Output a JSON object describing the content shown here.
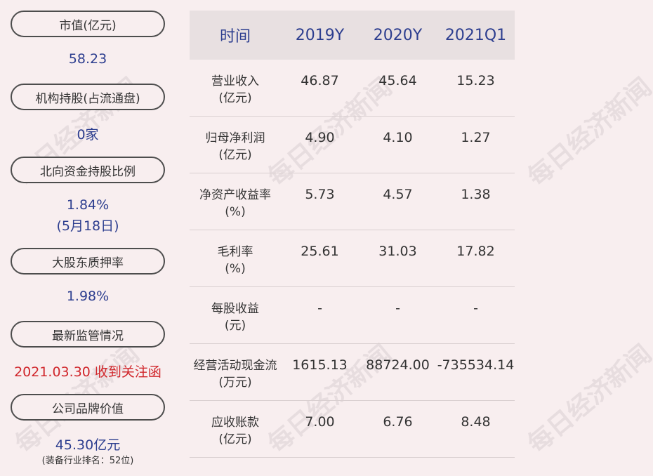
{
  "left_panel": {
    "items": [
      {
        "label": "市值(亿元)",
        "value": "58.23"
      },
      {
        "label": "机构持股(占流通盘)",
        "value": "0家"
      },
      {
        "label": "北向资金持股比例",
        "value_line1": "1.84%",
        "value_line2": "(5月18日)"
      },
      {
        "label": "大股东质押率",
        "value": "1.98%"
      },
      {
        "label": "最新监管情况",
        "value": "2021.03.30 收到关注函"
      },
      {
        "label": "公司品牌价值",
        "value": "45.30亿元",
        "note": "(装备行业排名：52位)"
      }
    ]
  },
  "table": {
    "headers": [
      "时间",
      "2019Y",
      "2020Y",
      "2021Q1"
    ],
    "rows": [
      {
        "name1": "营业收入",
        "name2": "(亿元)",
        "v": [
          "46.87",
          "45.64",
          "15.23"
        ]
      },
      {
        "name1": "归母净利润",
        "name2": "(亿元)",
        "v": [
          "4.90",
          "4.10",
          "1.27"
        ]
      },
      {
        "name1": "净资产收益率",
        "name2": "(%)",
        "v": [
          "5.73",
          "4.57",
          "1.38"
        ]
      },
      {
        "name1": "毛利率",
        "name2": "(%)",
        "v": [
          "25.61",
          "31.03",
          "17.82"
        ]
      },
      {
        "name1": "每股收益",
        "name2": "(元)",
        "v": [
          "-",
          "-",
          "-"
        ]
      },
      {
        "name1": "经营活动现金流",
        "name2": "(万元)",
        "v": [
          "1615.13",
          "88724.00",
          "-735534.14"
        ]
      },
      {
        "name1": "应收账款",
        "name2": "(亿元)",
        "v": [
          "7.00",
          "6.76",
          "8.48"
        ]
      }
    ]
  },
  "watermark": "每日经济新闻",
  "colors": {
    "background": "#f8eeef",
    "value_blue": "#2d3e8f",
    "alert_red": "#d0262b",
    "header_bg": "#e8e0e1"
  }
}
